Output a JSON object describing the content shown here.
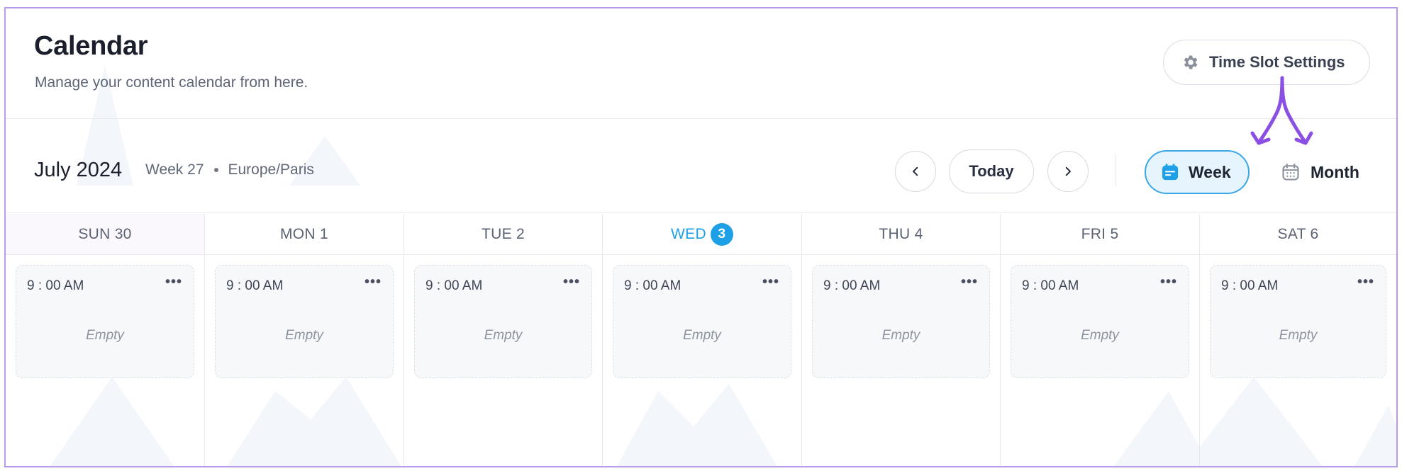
{
  "header": {
    "title": "Calendar",
    "subtitle": "Manage your content calendar from here.",
    "time_slot_settings_label": "Time Slot Settings"
  },
  "toolbar": {
    "period": "July 2024",
    "week_label": "Week 27",
    "timezone": "Europe/Paris",
    "today_label": "Today",
    "view_options": {
      "week": "Week",
      "month": "Month",
      "selected": "Week"
    }
  },
  "days": [
    {
      "label": "SUN 30",
      "weekend": true,
      "today": false,
      "slot_time": "9 : 00 AM",
      "slot_status": "Empty"
    },
    {
      "label": "MON 1",
      "weekend": false,
      "today": false,
      "slot_time": "9 : 00 AM",
      "slot_status": "Empty"
    },
    {
      "label": "TUE 2",
      "weekend": false,
      "today": false,
      "slot_time": "9 : 00 AM",
      "slot_status": "Empty"
    },
    {
      "label": "WED",
      "badge": "3",
      "weekend": false,
      "today": true,
      "slot_time": "9 : 00 AM",
      "slot_status": "Empty"
    },
    {
      "label": "THU 4",
      "weekend": false,
      "today": false,
      "slot_time": "9 : 00 AM",
      "slot_status": "Empty"
    },
    {
      "label": "FRI 5",
      "weekend": false,
      "today": false,
      "slot_time": "9 : 00 AM",
      "slot_status": "Empty"
    },
    {
      "label": "SAT 6",
      "weekend": false,
      "today": false,
      "slot_time": "9 : 00 AM",
      "slot_status": "Empty"
    }
  ],
  "slot_menu_label": "•••",
  "colors": {
    "accent": "#1ea0e6",
    "annotation": "#8b4fe3",
    "frame": "#b79cea"
  }
}
